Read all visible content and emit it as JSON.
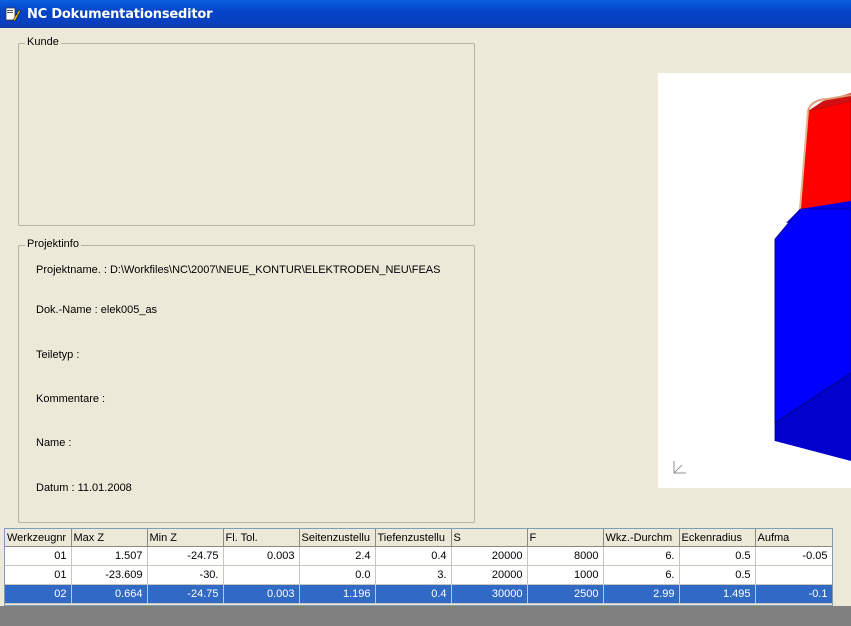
{
  "window": {
    "title": "NC Dokumentationseditor"
  },
  "kunde": {
    "caption": "Kunde"
  },
  "projektinfo": {
    "caption": "Projektinfo",
    "lines": [
      "Projektname. : D:\\Workfiles\\NC\\2007\\NEUE_KONTUR\\ELEKTRODEN_NEU\\FEAS",
      "Dok.-Name : elek005_as",
      "Teiletyp :",
      "Kommentare :",
      "Name :",
      "Datum : 11.01.2008"
    ]
  },
  "colors": {
    "titlebar": "#0544c8",
    "selection": "#316ac5",
    "red_face": "#ff0000",
    "blue_face": "#0000ff"
  },
  "table": {
    "headers": [
      "Werkzeugnr",
      "Max Z",
      "Min Z",
      "Fl. Tol.",
      "Seitenzustellu",
      "Tiefenzustellu",
      "S",
      "F",
      "Wkz.-Durchm",
      "Eckenradius",
      "Aufma"
    ],
    "rows": [
      [
        "01",
        "1.507",
        "-24.75",
        "0.003",
        "2.4",
        "0.4",
        "20000",
        "8000",
        "6.",
        "0.5",
        "-0.05"
      ],
      [
        "01",
        "-23.609",
        "-30.",
        "",
        "0.0",
        "3.",
        "20000",
        "1000",
        "6.",
        "0.5",
        ""
      ],
      [
        "02",
        "0.664",
        "-24.75",
        "0.003",
        "1.196",
        "0.4",
        "30000",
        "2500",
        "2.99",
        "1.495",
        "-0.1"
      ]
    ],
    "selected_row": 2
  }
}
